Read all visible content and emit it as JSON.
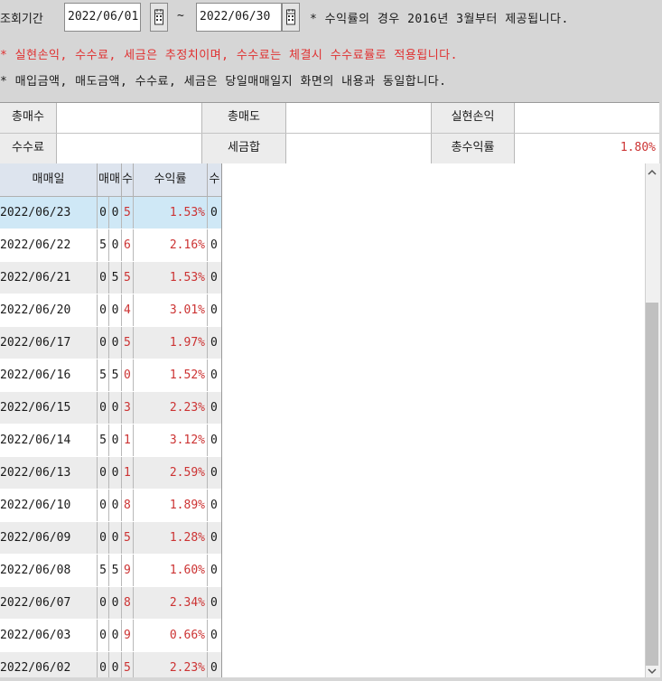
{
  "filter": {
    "label": "조회기간",
    "start_date": "2022/06/01",
    "end_date": "2022/06/30",
    "tilde": "~",
    "note1": "* 수익률의 경우 2016년 3월부터 제공됩니다.",
    "note2": "* 실현손익, 수수료, 세금은 추정치이며, 수수료는 체결시 수수료률로 적용됩니다.",
    "note3": "* 매입금액, 매도금액, 수수료, 세금은 당일매매일지 화면의 내용과 동일합니다."
  },
  "summary": {
    "total_buy_label": "총매수",
    "total_sell_label": "총매도",
    "realized_pl_label": "실현손익",
    "fee_label": "수수료",
    "tax_label": "세금합",
    "total_return_label": "총수익률",
    "total_return_value": "1.80%"
  },
  "grid": {
    "headers": [
      "매매일",
      "매매",
      "수",
      "수익률",
      "수"
    ],
    "rows": [
      {
        "date": "2022/06/23",
        "a": "0",
        "b": "0",
        "c": "5",
        "rate": "1.53%",
        "fee": "0"
      },
      {
        "date": "2022/06/22",
        "a": "5",
        "b": "0",
        "c": "6",
        "rate": "2.16%",
        "fee": "0"
      },
      {
        "date": "2022/06/21",
        "a": "0",
        "b": "5",
        "c": "5",
        "rate": "1.53%",
        "fee": "0"
      },
      {
        "date": "2022/06/20",
        "a": "0",
        "b": "0",
        "c": "4",
        "rate": "3.01%",
        "fee": "0"
      },
      {
        "date": "2022/06/17",
        "a": "0",
        "b": "0",
        "c": "5",
        "rate": "1.97%",
        "fee": "0"
      },
      {
        "date": "2022/06/16",
        "a": "5",
        "b": "5",
        "c": "0",
        "rate": "1.52%",
        "fee": "0"
      },
      {
        "date": "2022/06/15",
        "a": "0",
        "b": "0",
        "c": "3",
        "rate": "2.23%",
        "fee": "0"
      },
      {
        "date": "2022/06/14",
        "a": "5",
        "b": "0",
        "c": "1",
        "rate": "3.12%",
        "fee": "0"
      },
      {
        "date": "2022/06/13",
        "a": "0",
        "b": "0",
        "c": "1",
        "rate": "2.59%",
        "fee": "0"
      },
      {
        "date": "2022/06/10",
        "a": "0",
        "b": "0",
        "c": "8",
        "rate": "1.89%",
        "fee": "0"
      },
      {
        "date": "2022/06/09",
        "a": "0",
        "b": "0",
        "c": "5",
        "rate": "1.28%",
        "fee": "0"
      },
      {
        "date": "2022/06/08",
        "a": "5",
        "b": "5",
        "c": "9",
        "rate": "1.60%",
        "fee": "0"
      },
      {
        "date": "2022/06/07",
        "a": "0",
        "b": "0",
        "c": "8",
        "rate": "2.34%",
        "fee": "0"
      },
      {
        "date": "2022/06/03",
        "a": "0",
        "b": "0",
        "c": "9",
        "rate": "0.66%",
        "fee": "0"
      },
      {
        "date": "2022/06/02",
        "a": "0",
        "b": "0",
        "c": "5",
        "rate": "2.23%",
        "fee": "0"
      }
    ]
  },
  "colors": {
    "accent_red": "#cc3333",
    "note_red": "#e03030",
    "selected_row": "#cfe8f6",
    "header_bg": "#dde4ee"
  },
  "icons": {
    "calendar": "calendar-icon",
    "scroll_up": "chevron-up-icon",
    "scroll_down": "chevron-down-icon"
  }
}
